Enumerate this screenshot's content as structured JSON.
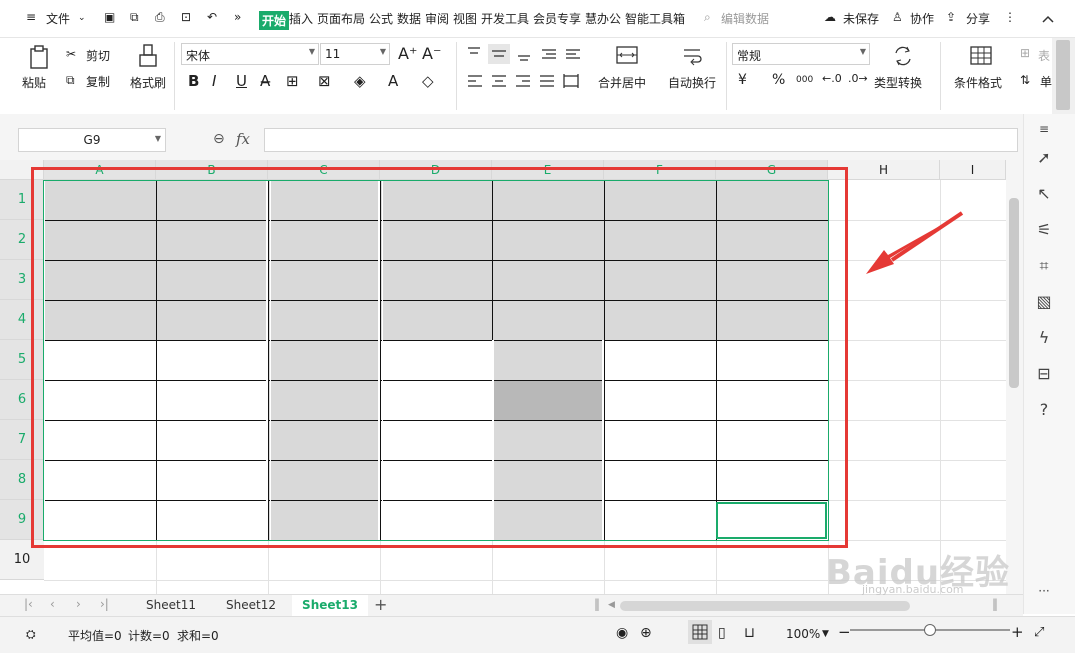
{
  "menubar": {
    "file_label": "文件",
    "tabs": [
      "开始",
      "插入",
      "页面布局",
      "公式",
      "数据",
      "审阅",
      "视图",
      "开发工具",
      "会员专享",
      "慧办公",
      "智能工具箱"
    ],
    "search_placeholder": "编辑数据",
    "unsaved_label": "未保存",
    "collab_label": "协作",
    "share_label": "分享",
    "more_glyph": "»"
  },
  "ribbon": {
    "paste": "粘贴",
    "cut": "剪切",
    "copy": "复制",
    "format_painter": "格式刷",
    "font_name": "宋体",
    "font_size": "11",
    "merge_center": "合并居中",
    "wrap_text": "自动换行",
    "number_format": "常规",
    "type_convert": "类型转换",
    "cond_format": "条件格式",
    "table_style_partial": "表",
    "cell_partial": "单",
    "bold": "B",
    "italic": "I",
    "underline": "U",
    "currency": "¥",
    "percent": "%",
    "thousands": "000"
  },
  "formula_bar": {
    "name_box": "G9",
    "fx": "fx",
    "value": ""
  },
  "grid": {
    "columns": [
      "A",
      "B",
      "C",
      "D",
      "E",
      "F",
      "G",
      "H",
      "I"
    ],
    "rows": [
      "1",
      "2",
      "3",
      "4",
      "5",
      "6",
      "7",
      "8",
      "9",
      "10"
    ]
  },
  "sheets": {
    "tabs": [
      "Sheet11",
      "Sheet12",
      "Sheet13"
    ],
    "active": "Sheet13"
  },
  "statusbar": {
    "average": "平均值=0",
    "count": "计数=0",
    "sum": "求和=0",
    "zoom": "100%"
  },
  "watermark": {
    "brand": "Baidu经验",
    "url": "jingyan.baidu.com"
  },
  "colors": {
    "accent": "#1aab6b",
    "highlight_box": "#e53935",
    "cell_fill": "#d9d9d9",
    "cell_fill_dark": "#b8b8b8"
  }
}
